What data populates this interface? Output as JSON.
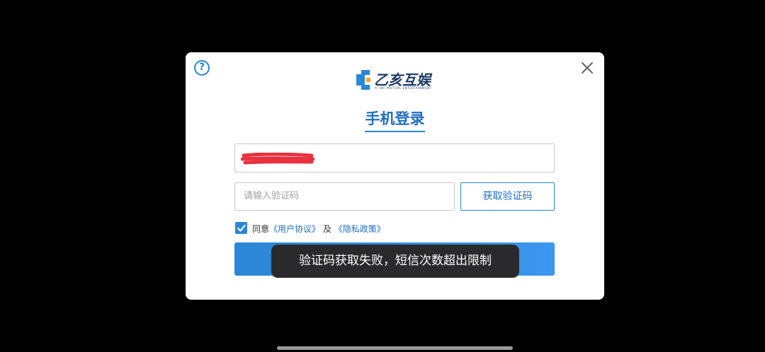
{
  "dialog": {
    "help_icon_glyph": "?",
    "help_icon": "question-circle-icon",
    "close_icon": "close-icon",
    "logo": {
      "text": "乙亥互娱",
      "subtitle": "YI HAI MUTUAL ENTERTAINMENT"
    },
    "title": "手机登录",
    "phone_input": {
      "value": "",
      "redacted": true
    },
    "code_input": {
      "placeholder": "请输入验证码"
    },
    "get_code_label": "获取验证码",
    "agreement": {
      "checked": true,
      "prefix": "同意",
      "user_agreement": "《用户协议》",
      "and": "及",
      "privacy_policy": "《隐私政策》"
    }
  },
  "toast": {
    "message": "验证码获取失败，短信次数超出限制"
  },
  "colors": {
    "accent": "#2a86d6",
    "title": "#1f6fc0",
    "redaction": "#e8313f",
    "toast_bg": "#2a2a2c"
  }
}
